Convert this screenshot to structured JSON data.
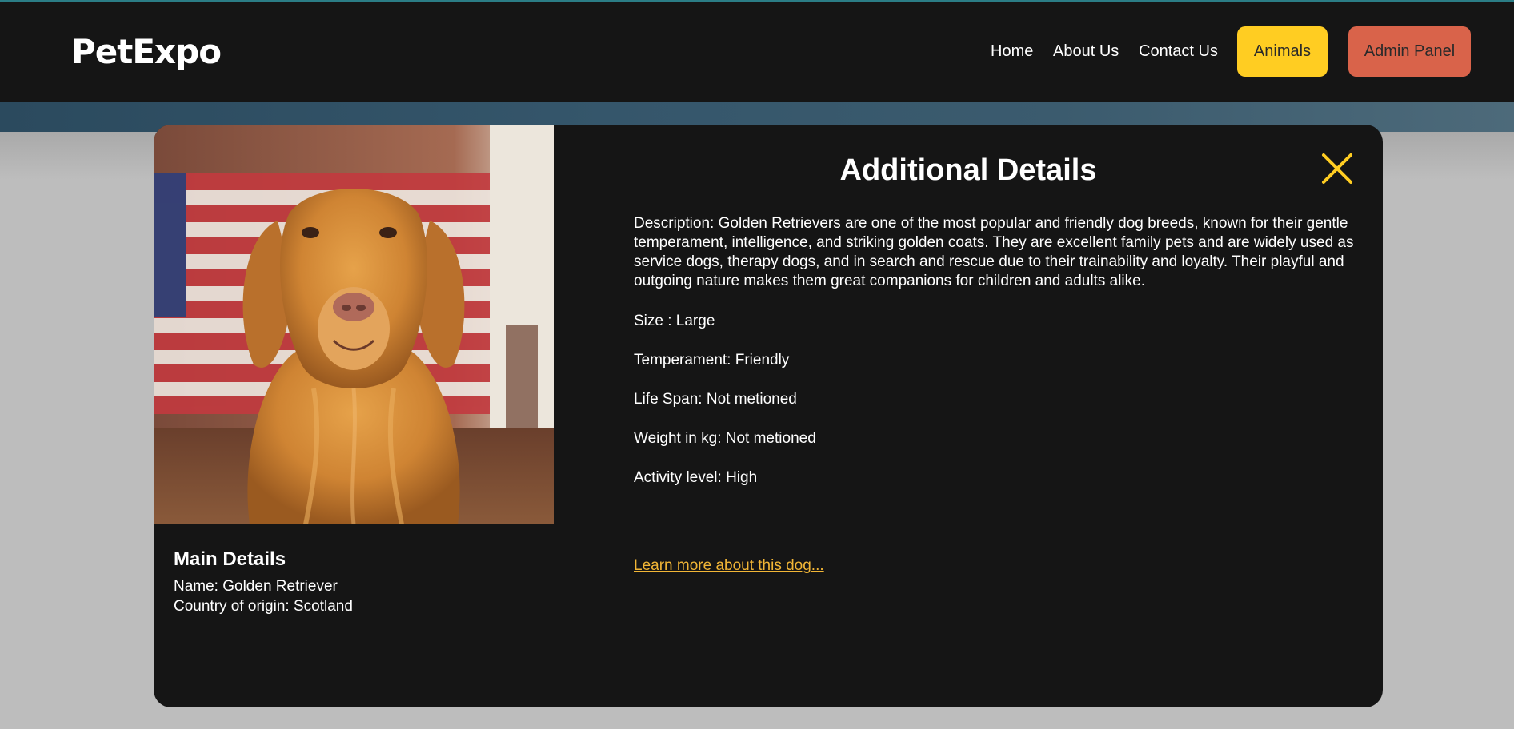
{
  "brand": {
    "logo_text": "PetExpo"
  },
  "nav": {
    "home": "Home",
    "about": "About Us",
    "contact": "Contact Us",
    "animals_button": "Animals",
    "admin_button": "Admin Panel"
  },
  "colors": {
    "accent_yellow": "#ffcd22",
    "accent_orange": "#d9634a",
    "link": "#f2b636",
    "panel_bg": "#151515"
  },
  "modal": {
    "title": "Additional Details",
    "close_icon": "close-icon",
    "image_subject": "golden retriever dog photo",
    "description": "Description: Golden Retrievers are one of the most popular and friendly dog breeds, known for their gentle temperament, intelligence, and striking golden coats. They are excellent family pets and are widely used as service dogs, therapy dogs, and in search and rescue due to their trainability and loyalty. Their playful and outgoing nature makes them great companions for children and adults alike.",
    "size": "Size : Large",
    "temperament": "Temperament: Friendly",
    "life_span": "Life Span: Not metioned",
    "weight": "Weight in kg: Not metioned",
    "activity": "Activity level: High",
    "learn_more": "Learn more about this dog...",
    "main_details": {
      "title": "Main Details",
      "name": "Name: Golden Retriever",
      "origin": "Country of origin: Scotland"
    }
  }
}
